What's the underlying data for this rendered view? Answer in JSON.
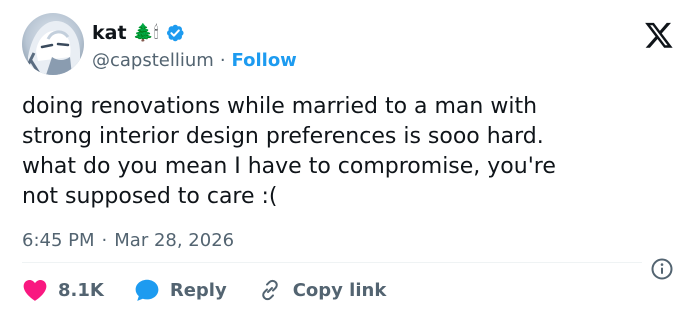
{
  "author": {
    "display_name": "kat",
    "emoji_badges": "🌲🕯",
    "handle": "@capstellium",
    "separator": "·",
    "follow_label": "Follow"
  },
  "tweet": {
    "text": "doing renovations while married to a man with\nstrong interior design preferences is sooo hard.\nwhat do you mean I have to compromise, you're\nnot supposed to care :(",
    "time": "6:45 PM",
    "separator": "·",
    "date": "Mar 28, 2026"
  },
  "actions": {
    "likes": "8.1K",
    "reply_label": "Reply",
    "copy_label": "Copy link"
  },
  "colors": {
    "accent": "#1d9bf0",
    "like": "#f91880",
    "muted": "#536471",
    "text": "#0f1419"
  },
  "icons": [
    "verified-badge-icon",
    "x-logo-icon",
    "info-icon",
    "heart-icon",
    "reply-bubble-icon",
    "link-icon"
  ]
}
